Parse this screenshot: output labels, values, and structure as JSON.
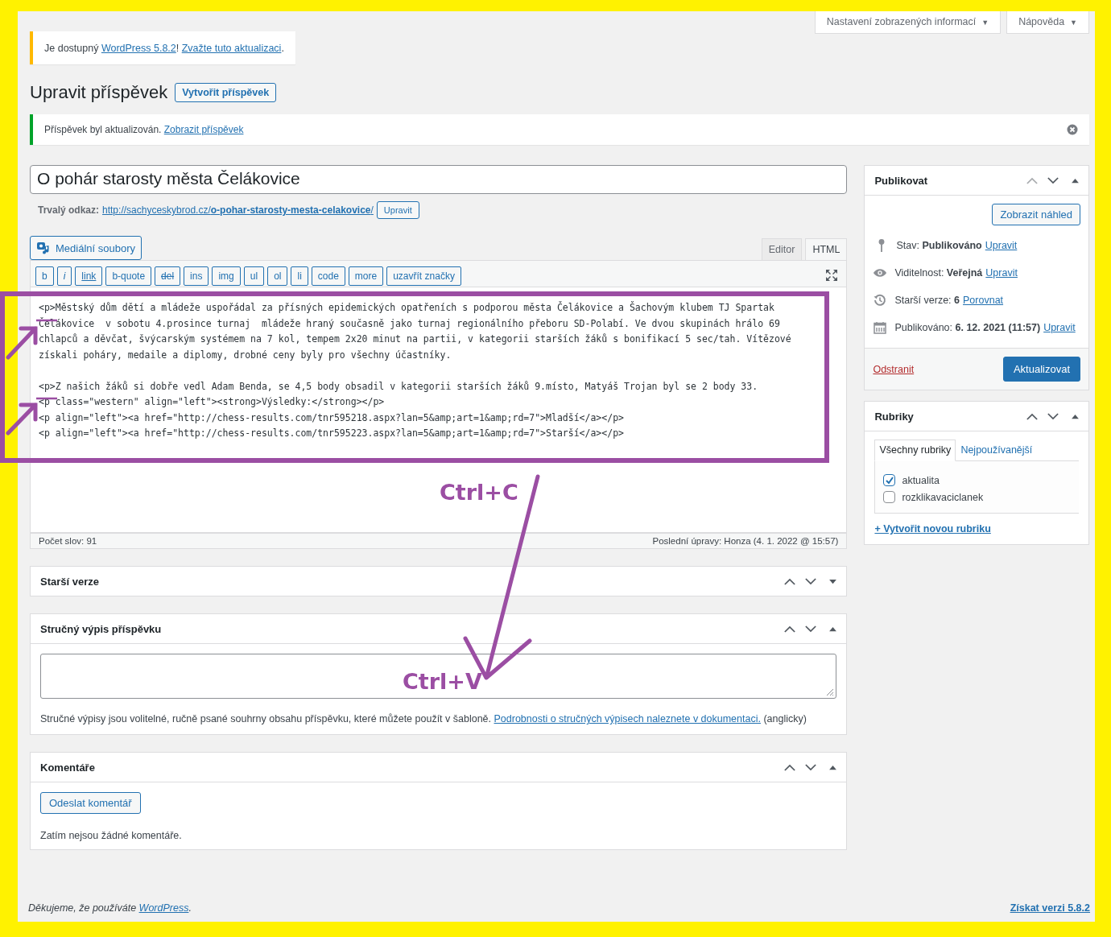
{
  "screen_options": [
    {
      "label": "Nastavení zobrazených informací",
      "caret": "▼"
    },
    {
      "label": "Nápověda",
      "caret": "▼"
    }
  ],
  "update_notice": {
    "text": "Je dostupný",
    "link1": "WordPress 5.8.2",
    "sep": "!",
    "link2": "Zvažte tuto aktualizaci",
    "end": "."
  },
  "heading": "Upravit příspěvek",
  "add_button": "Vytvořit příspěvek",
  "updated_notice": {
    "text": "Příspěvek byl aktualizován.",
    "link": "Zobrazit příspěvek"
  },
  "title": "O pohár starosty města Čelákovice",
  "permalink": {
    "label": "Trvalý odkaz:",
    "url_base": "http://sachyceskybrod.cz/",
    "slug": "o-pohar-starosty-mesta-celakovice",
    "end": "/",
    "button": "Upravit"
  },
  "media_button": "Mediální soubory",
  "editor_tabs": [
    {
      "label": "Editor",
      "selected": false
    },
    {
      "label": "HTML",
      "selected": true
    }
  ],
  "quicktags": [
    {
      "label": "b",
      "kind": "plain"
    },
    {
      "label": "i",
      "kind": "italic"
    },
    {
      "label": "link",
      "kind": "link"
    },
    {
      "label": "b-quote",
      "kind": "plain"
    },
    {
      "label": "del",
      "kind": "strike"
    },
    {
      "label": "ins",
      "kind": "plain"
    },
    {
      "label": "img",
      "kind": "plain"
    },
    {
      "label": "ul",
      "kind": "plain"
    },
    {
      "label": "ol",
      "kind": "plain"
    },
    {
      "label": "li",
      "kind": "plain"
    },
    {
      "label": "code",
      "kind": "plain"
    },
    {
      "label": "more",
      "kind": "plain"
    },
    {
      "label": "uzavřít značky",
      "kind": "plain"
    }
  ],
  "code_blocks": [
    [
      "<p>Městský dům dětí a mládeže uspořádal za přísných epidemických opatřeních s podporou města Čelákovice a Šachovým klubem TJ Spartak Čelákovice  v sobotu 4.prosince turnaj  mládeže hraný současně jako turnaj regionálního přeboru SD-Polabí. Ve dvou skupinách hrálo 69 chlapců a děvčat, švýcarským systémem na 7 kol, tempem 2x20 minut na partii, v kategorii starších žáků s bonifikací 5 sec/tah. Vítězové získali poháry, medaile a diplomy, drobné ceny byly pro všechny účastníky."
    ],
    [
      "<p>Z našich žáků si dobře vedl Adam Benda, se 4,5 body obsadil v kategorii starších žáků 9.místo, Matyáš Trojan byl se 2 body 33.",
      "<p class=\"western\" align=\"left\"><strong>Výsledky:</strong></p>",
      "<p align=\"left\"><a href=\"http://chess-results.com/tnr595218.aspx?lan=5&amp;art=1&amp;rd=7\">Mladší</a></p>",
      "<p align=\"left\"><a href=\"http://chess-results.com/tnr595223.aspx?lan=5&amp;art=1&amp;rd=7\">Starší</a></p>"
    ]
  ],
  "word_count": "Počet slov: 91",
  "last_edit": "Poslední úpravy: Honza (4. 1. 2022 @ 15:57)",
  "metaboxes": [
    {
      "kind": "revisions",
      "title": "Starší verze",
      "expanded": false
    },
    {
      "kind": "excerpt",
      "title": "Stručný výpis příspěvku",
      "expanded": true,
      "help": "Stručné výpisy jsou volitelné, ručně psané souhrny obsahu příspěvku, které můžete použít v šabloně.",
      "help_link": "Podrobnosti o stručných výpisech naleznete v dokumentaci.",
      "help_end": "(anglicky)"
    },
    {
      "kind": "comments",
      "title": "Komentáře",
      "expanded": true,
      "button": "Odeslat komentář",
      "empty": "Zatím nejsou žádné komentáře."
    }
  ],
  "publish": {
    "title": "Publikovat",
    "preview": "Zobrazit náhled",
    "rows": [
      {
        "kind": "pin",
        "label": "Stav:",
        "value": "Publikováno",
        "link": "Upravit"
      },
      {
        "kind": "eye",
        "label": "Viditelnost:",
        "value": "Veřejná",
        "link": "Upravit"
      },
      {
        "kind": "history",
        "label": "Starší verze:",
        "value": "6",
        "link": "Porovnat"
      },
      {
        "kind": "calendar",
        "label": "Publikováno:",
        "value": "6. 12. 2021 (11:57)",
        "link": "Upravit"
      }
    ],
    "delete": "Odstranit",
    "update": "Aktualizovat"
  },
  "categories": {
    "title": "Rubriky",
    "tabs": [
      {
        "label": "Všechny rubriky",
        "selected": true
      },
      {
        "label": "Nejpoužívanější",
        "selected": false
      }
    ],
    "items": [
      {
        "label": "aktualita",
        "checked": true
      },
      {
        "label": "rozklikavaciclanek",
        "checked": false
      }
    ],
    "add": "+ Vytvořit novou rubriku"
  },
  "footer": {
    "text": "Děkujeme, že používáte",
    "link": "WordPress",
    "end": ".",
    "version": "Získat verzi 5.8.2"
  },
  "annotations": {
    "copy": "Ctrl+C",
    "paste": "Ctrl+V"
  }
}
